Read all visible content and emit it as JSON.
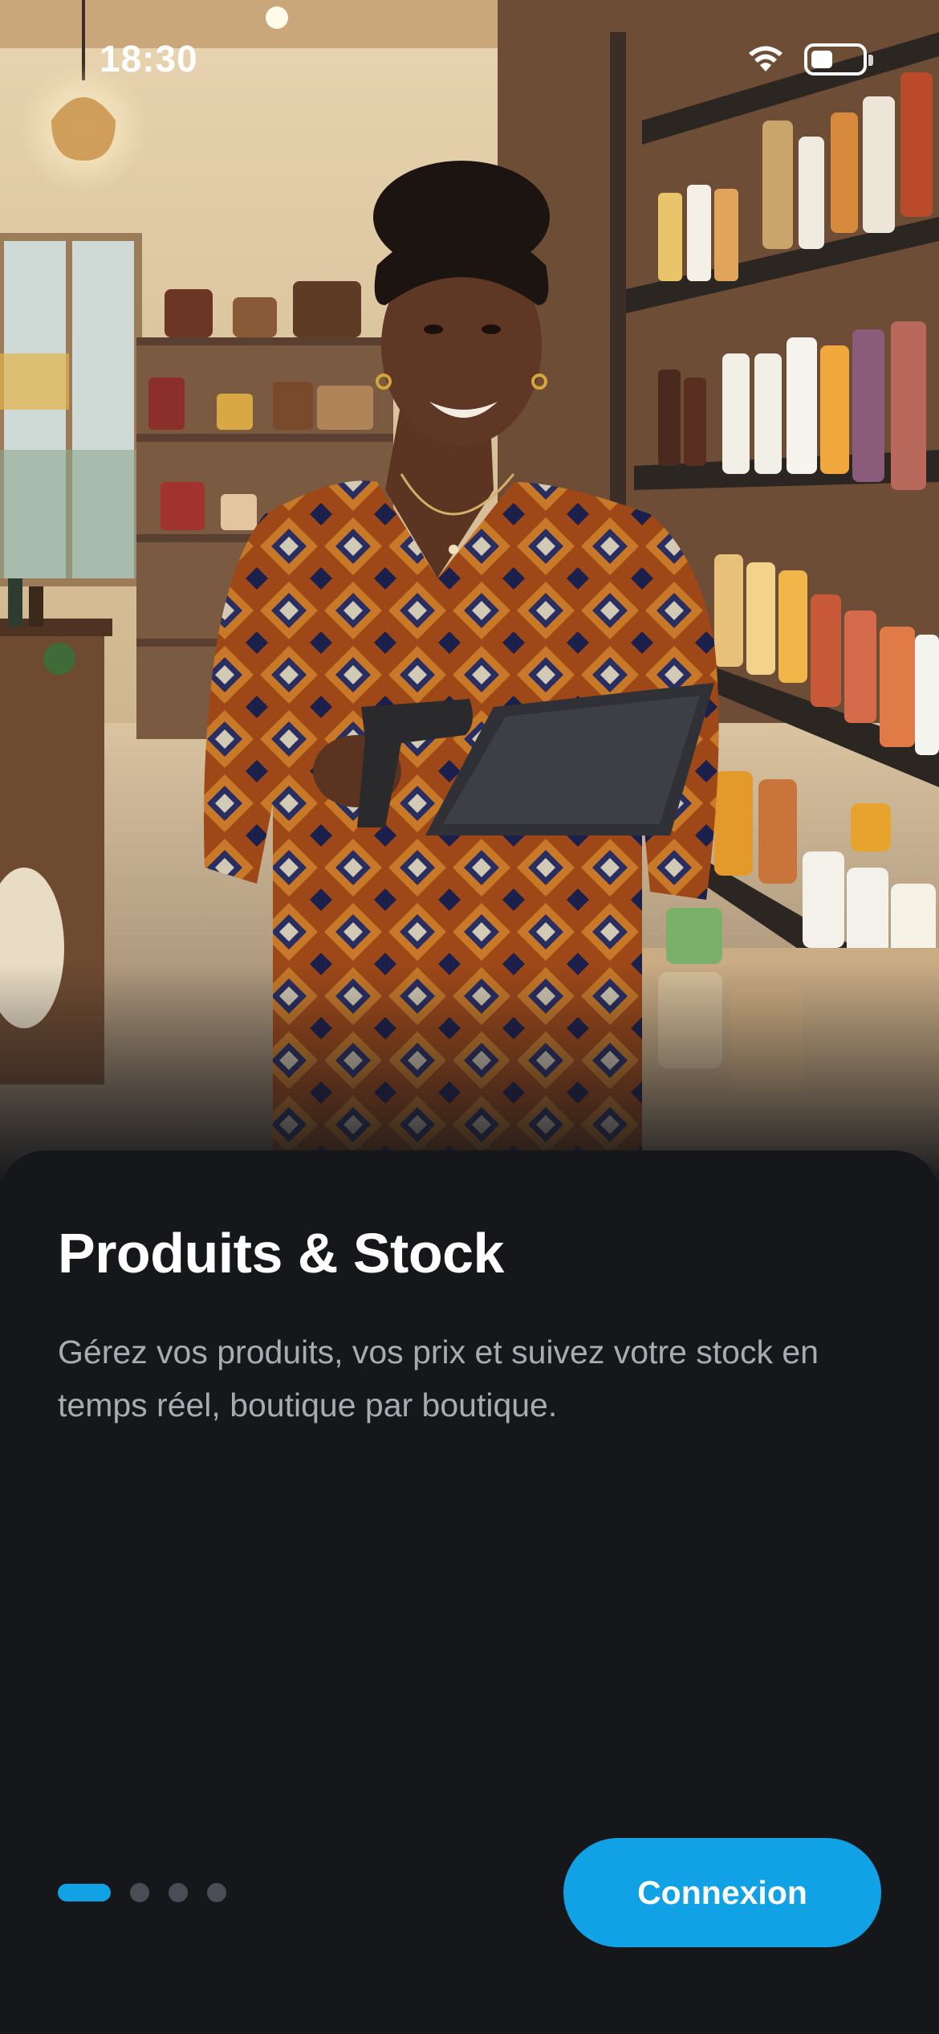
{
  "status_bar": {
    "time": "18:30",
    "icons": [
      "signal-icon",
      "wifi-icon",
      "battery-icon"
    ]
  },
  "hero": {
    "image_subject": "hero-photo"
  },
  "onboarding": {
    "title": "Produits & Stock",
    "description": "Gérez vos produits, vos prix et suivez votre stock en temps réel, boutique par boutique.",
    "pager": {
      "total": 4,
      "active_index": 0
    },
    "login_button_label": "Connexion"
  },
  "colors": {
    "background": "#15171b",
    "accent": "#10a2e4",
    "title": "#ffffff",
    "body_text": "#a9abb1",
    "inactive_dot": "#4a4d55"
  }
}
